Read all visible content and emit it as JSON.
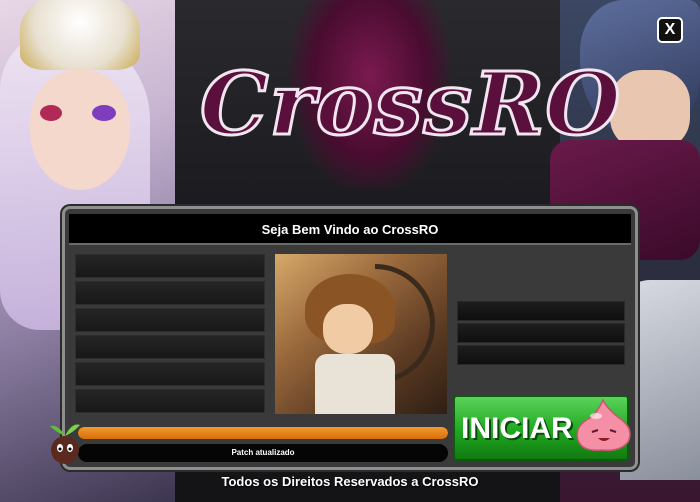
{
  "window": {
    "close_label": "X"
  },
  "logo": {
    "text": "CrossRO"
  },
  "panel": {
    "header": "Seja Bem Vindo ao CrossRO",
    "news_items": [
      "",
      "",
      "",
      "",
      "",
      ""
    ],
    "link_items": [
      "",
      "",
      ""
    ]
  },
  "progress": {
    "fraction": 1.0
  },
  "status": {
    "text": "Patch atualizado"
  },
  "start_button": {
    "label": "INICIAR"
  },
  "footer": {
    "text": "Todos os Direitos Reservados a CrossRO"
  },
  "colors": {
    "progress": "#e07d16",
    "start_button": "#22aa22",
    "logo": "#5a0f3c"
  }
}
